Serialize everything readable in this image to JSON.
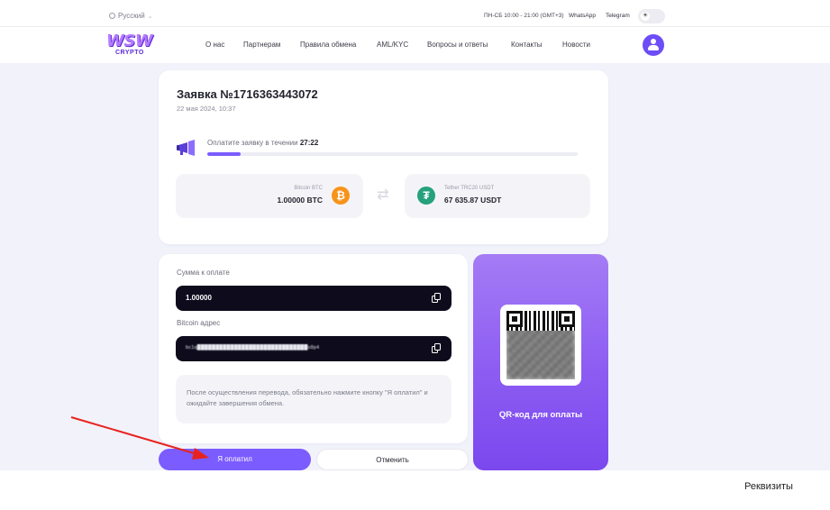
{
  "topbar": {
    "language": "Русский",
    "hours": "ПН-СБ 10:00 - 21:00 (GMT+3)",
    "whatsapp": "WhatsApp",
    "telegram": "Telegram"
  },
  "logo": {
    "line1": "WSW",
    "line2": "CRYPTO"
  },
  "nav": {
    "items": [
      {
        "label": "О нас"
      },
      {
        "label": "Партнерам"
      },
      {
        "label": "Правила обмена"
      },
      {
        "label": "AML/KYC"
      },
      {
        "label": "Вопросы и ответы"
      },
      {
        "label": "Контакты"
      },
      {
        "label": "Новости"
      }
    ]
  },
  "order": {
    "title": "Заявка №1716363443072",
    "date": "22 мая 2024, 10:37",
    "timer_prefix": "Оплатите заявку в течении",
    "timer_value": "27:22",
    "progress_fraction": 0.09
  },
  "exchange": {
    "from": {
      "label": "Bitcoin BTC",
      "amount": "1.00000 BTC",
      "icon": "bitcoin-icon",
      "symbol": "₿",
      "color": "#f7931a"
    },
    "to": {
      "label": "Tether TRC20 USDT",
      "amount": "67 635.87 USDT",
      "icon": "tether-icon",
      "symbol": "₮",
      "color": "#26a17b"
    }
  },
  "payment": {
    "amount_label": "Сумма к оплате",
    "amount_value": "1.00000",
    "address_label": "Bitcoin адрес",
    "address_value": "bc1q██████████████████████████████s8p4",
    "note": "После осуществления перевода, обязательно нажмите кнопку \"Я оплатил\" и ожидайте завершения обмена."
  },
  "qr": {
    "caption": "QR-код для оплаты"
  },
  "buttons": {
    "paid": "Я оплатил",
    "cancel": "Отменить"
  },
  "caption": "Реквизиты",
  "colors": {
    "accent": "#7b5cff",
    "dark_field": "#0d0b1c",
    "annotation_arrow": "#e8231f"
  }
}
